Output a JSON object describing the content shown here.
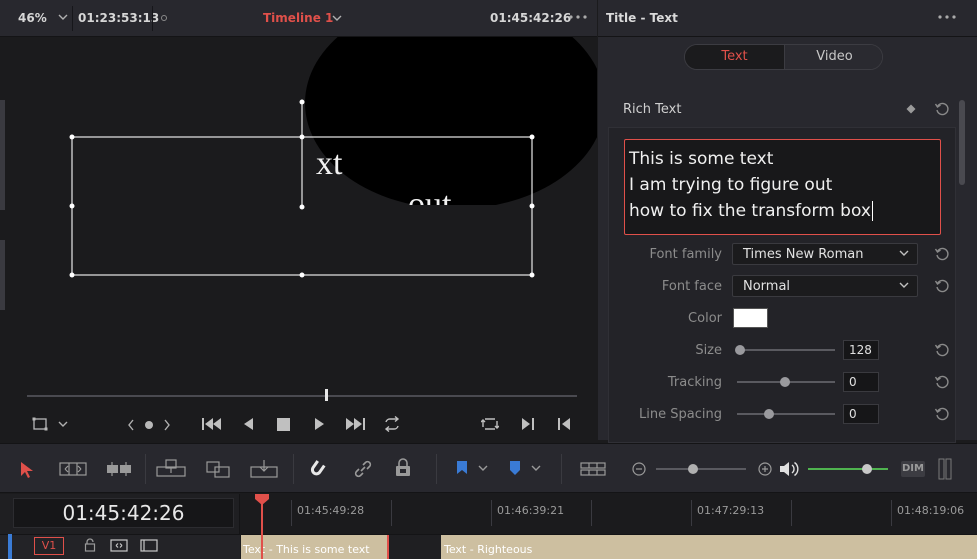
{
  "viewer": {
    "zoom": "46%",
    "source_timecode": "01:23:53:13",
    "timeline_name": "Timeline 1",
    "timeline_timecode": "01:45:42:26",
    "canvas_text_1": "xt",
    "canvas_text_2": "out"
  },
  "inspector": {
    "title": "Title - Text",
    "tabs": [
      {
        "label": "Text",
        "active": true
      },
      {
        "label": "Video",
        "active": false
      }
    ],
    "rich_text_label": "Rich Text",
    "rich_text_lines": [
      "This is some text",
      "I am trying to figure out",
      "how to fix the transform box"
    ],
    "font_family_label": "Font family",
    "font_family_value": "Times New Roman",
    "font_face_label": "Font face",
    "font_face_value": "Normal",
    "color_label": "Color",
    "color_value": "#ffffff",
    "size_label": "Size",
    "size_value": "128",
    "tracking_label": "Tracking",
    "tracking_value": "0",
    "line_spacing_label": "Line Spacing",
    "line_spacing_value": "0"
  },
  "timeline": {
    "current_timecode": "01:45:42:26",
    "ruler": [
      "01:45:49:28",
      "01:46:39:21",
      "01:47:29:13",
      "01:48:19:06"
    ],
    "track_label": "V1",
    "clips": [
      "Text - This is some text",
      "Text - Righteous"
    ]
  },
  "toolbar": {
    "dim_label": "DIM"
  },
  "colors": {
    "accent_red": "#e0504a",
    "panel": "#28282e",
    "background": "#1b1b1d",
    "clip": "#cdbfa0",
    "volume_green": "#4fb34f"
  }
}
